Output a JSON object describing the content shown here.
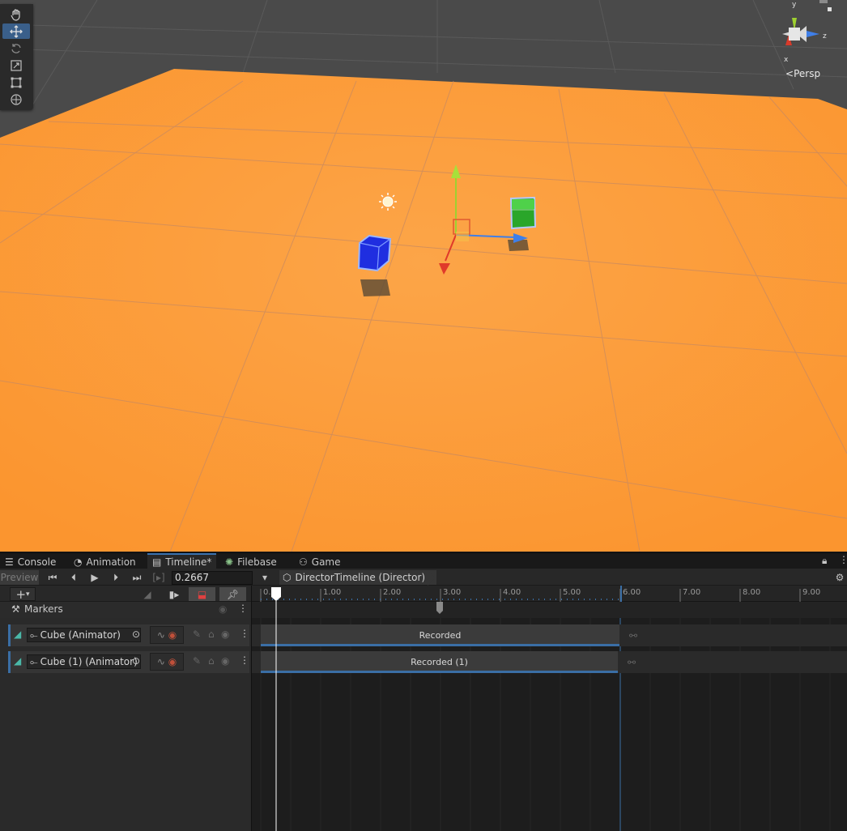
{
  "scene": {
    "view_label": "Persp",
    "axes": {
      "x": "x",
      "y": "y",
      "z": "z"
    },
    "colors": {
      "ground": "#fb9a3a",
      "sky": "#4a4a4a",
      "cube_blue": "#1f2ee0",
      "cube_green": "#2aa62a"
    }
  },
  "tools": [
    "hand-tool",
    "move-tool",
    "rotate-tool",
    "scale-tool",
    "rect-tool",
    "transform-tool"
  ],
  "tabs": [
    {
      "label": "Console",
      "icon": "console-icon"
    },
    {
      "label": "Animation",
      "icon": "animation-icon"
    },
    {
      "label": "Timeline*",
      "icon": "timeline-icon",
      "active": true
    },
    {
      "label": "Filebase",
      "icon": "filebase-icon"
    },
    {
      "label": "Game",
      "icon": "game-icon"
    }
  ],
  "toolbar": {
    "preview_label": "Preview",
    "time_value": "0.2667",
    "breadcrumb": "DirectorTimeline (Director)"
  },
  "markers_label": "Markers",
  "ruler": {
    "labels": [
      "0.",
      "1.00",
      "2.00",
      "3.00",
      "4.00",
      "5.00",
      "6.00",
      "7.00",
      "8.00",
      "9.00"
    ]
  },
  "tracks": [
    {
      "name": "Cube (Animator)",
      "clip": "Recorded"
    },
    {
      "name": "Cube (1) (Animator)",
      "clip": "Recorded (1)"
    }
  ]
}
